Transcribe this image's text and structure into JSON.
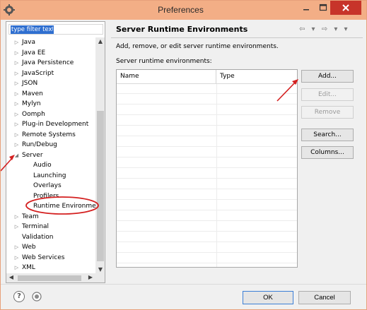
{
  "window": {
    "title": "Preferences",
    "icon": "eclipse-gear-icon",
    "controls": [
      "minimize-icon",
      "maximize-icon",
      "close-icon"
    ]
  },
  "left": {
    "filter": {
      "value": "type filter text"
    },
    "tree": [
      {
        "label": "Java",
        "indent": 0,
        "expander": "▷"
      },
      {
        "label": "Java EE",
        "indent": 0,
        "expander": "▷"
      },
      {
        "label": "Java Persistence",
        "indent": 0,
        "expander": "▷"
      },
      {
        "label": "JavaScript",
        "indent": 0,
        "expander": "▷"
      },
      {
        "label": "JSON",
        "indent": 0,
        "expander": "▷"
      },
      {
        "label": "Maven",
        "indent": 0,
        "expander": "▷"
      },
      {
        "label": "Mylyn",
        "indent": 0,
        "expander": "▷"
      },
      {
        "label": "Oomph",
        "indent": 0,
        "expander": "▷"
      },
      {
        "label": "Plug-in Development",
        "indent": 0,
        "expander": "▷"
      },
      {
        "label": "Remote Systems",
        "indent": 0,
        "expander": "▷"
      },
      {
        "label": "Run/Debug",
        "indent": 0,
        "expander": "▷"
      },
      {
        "label": "Server",
        "indent": 0,
        "expander": "◢"
      },
      {
        "label": "Audio",
        "indent": 1,
        "expander": ""
      },
      {
        "label": "Launching",
        "indent": 1,
        "expander": ""
      },
      {
        "label": "Overlays",
        "indent": 1,
        "expander": ""
      },
      {
        "label": "Profilers",
        "indent": 1,
        "expander": ""
      },
      {
        "label": "Runtime Environme",
        "indent": 1,
        "expander": ""
      },
      {
        "label": "Team",
        "indent": 0,
        "expander": "▷"
      },
      {
        "label": "Terminal",
        "indent": 0,
        "expander": "▷"
      },
      {
        "label": "Validation",
        "indent": 0,
        "expander": ""
      },
      {
        "label": "Web",
        "indent": 0,
        "expander": "▷"
      },
      {
        "label": "Web Services",
        "indent": 0,
        "expander": "▷"
      },
      {
        "label": "XML",
        "indent": 0,
        "expander": "▷"
      }
    ]
  },
  "main": {
    "title": "Server Runtime Environments",
    "nav_icons": "⇦ ▾ ⇨ ▾ ▾",
    "description": "Add, remove, or edit server runtime environments.",
    "list_label": "Server runtime environments:",
    "columns": [
      "Name",
      "Type"
    ],
    "rows": [],
    "buttons": {
      "add": "Add...",
      "edit": "Edit...",
      "remove": "Remove",
      "search": "Search...",
      "columns": "Columns..."
    }
  },
  "footer": {
    "help_icon": "help-icon",
    "record_icon": "record-icon",
    "ok": "OK",
    "cancel": "Cancel"
  },
  "annotations": {
    "arrow_color": "#d42020",
    "circle_color": "#d42020"
  },
  "colors": {
    "titlebar": "#f3ae86",
    "close_button": "#c7342a",
    "selection": "#2f6fd0"
  }
}
